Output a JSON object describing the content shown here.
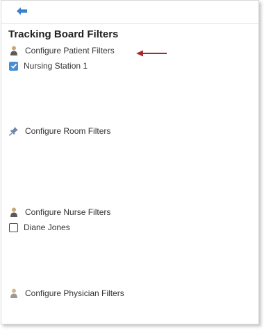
{
  "panel": {
    "title": "Tracking Board Filters"
  },
  "sections": {
    "patient": {
      "label": "Configure Patient Filters",
      "icon": "person-icon"
    },
    "room": {
      "label": "Configure Room Filters",
      "icon": "pushpin-icon"
    },
    "nurse": {
      "label": "Configure Nurse Filters",
      "icon": "person-icon"
    },
    "physician": {
      "label": "Configure Physician Filters",
      "icon": "person-icon"
    }
  },
  "filters": {
    "nursing_station": {
      "label": "Nursing Station 1",
      "checked": true
    },
    "nurse_diane": {
      "label": "Diane Jones",
      "checked": false
    }
  },
  "colors": {
    "checkbox_accent": "#4a8fd4",
    "back_arrow": "#3b7fd0",
    "annotation_arrow": "#a32a2a"
  }
}
